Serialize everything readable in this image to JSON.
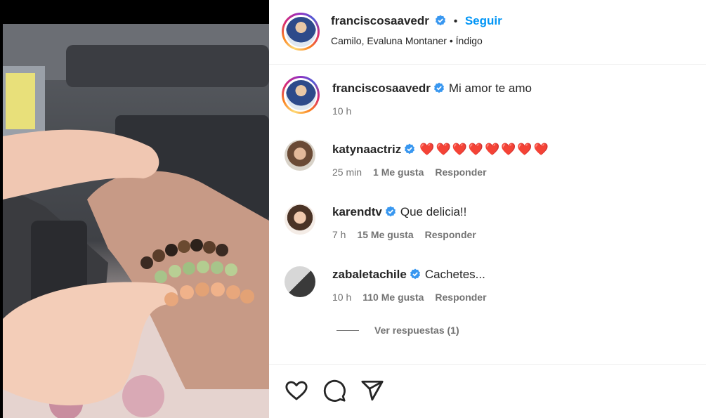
{
  "post": {
    "author": "franciscosaavedr",
    "follow_label": "Seguir",
    "separator": "•",
    "audio": "Camilo, Evaluna Montaner • Índigo"
  },
  "caption": {
    "username": "franciscosaavedr",
    "text": "Mi amor te amo",
    "time": "10 h"
  },
  "comments": [
    {
      "username": "katynaactriz",
      "text": "❤️❤️❤️❤️❤️❤️❤️❤️",
      "time": "25 min",
      "likes": "1 Me gusta",
      "reply": "Responder"
    },
    {
      "username": "karendtv",
      "text": "Que delicia!!",
      "time": "7 h",
      "likes": "15 Me gusta",
      "reply": "Responder"
    },
    {
      "username": "zabaletachile",
      "text": "Cachetes...",
      "time": "10 h",
      "likes": "110 Me gusta",
      "reply": "Responder"
    }
  ],
  "view_replies": "Ver respuestas (1)",
  "icons": {
    "like": "heart-icon",
    "comment": "comment-icon",
    "share": "share-icon",
    "verified": "verified-badge-icon"
  },
  "colors": {
    "link": "#0095f6",
    "verified": "#3897f0",
    "muted": "#737373"
  }
}
